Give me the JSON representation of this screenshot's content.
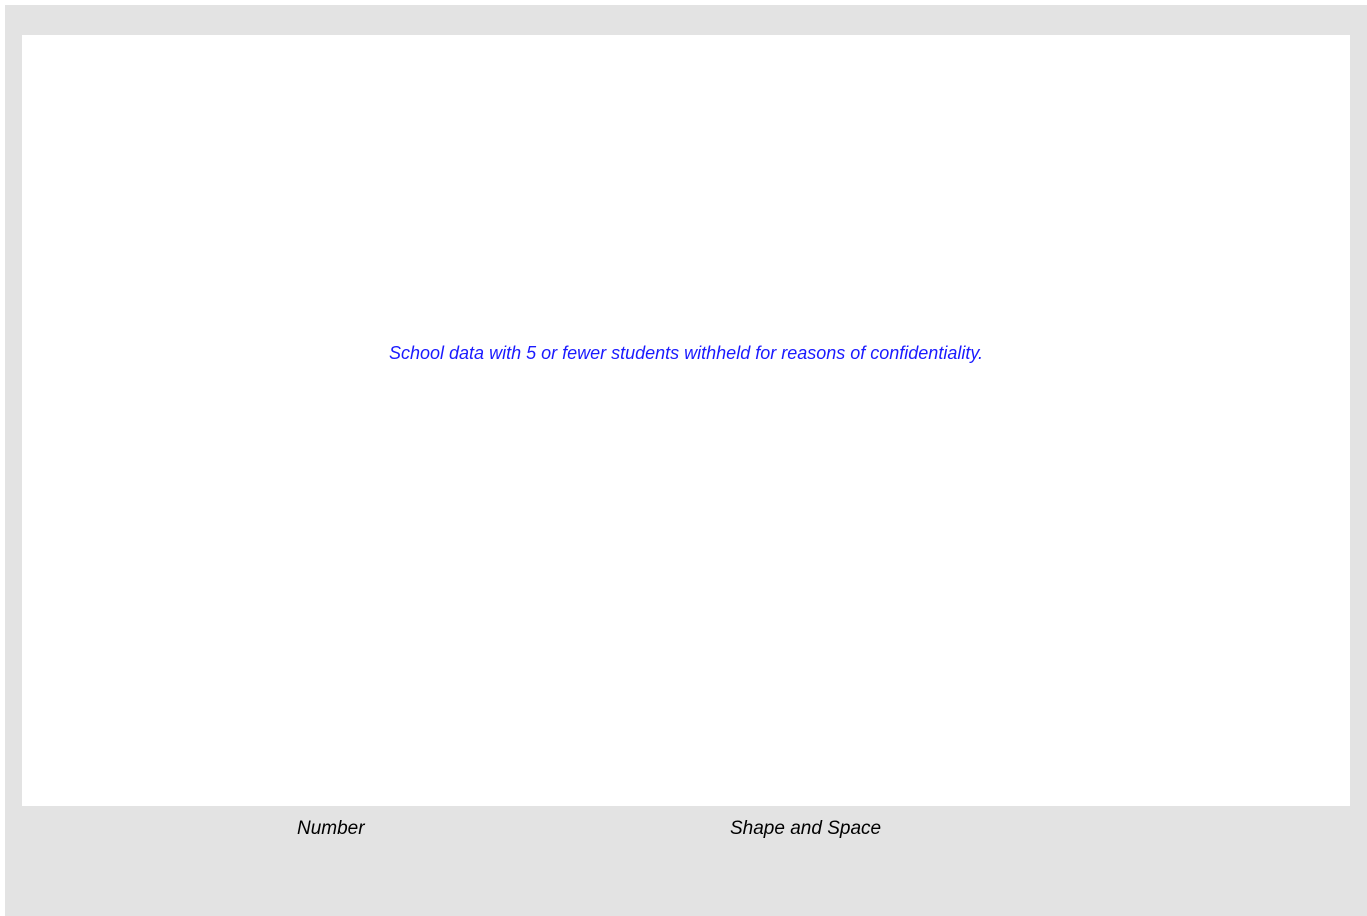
{
  "chart_data": {
    "type": "bar",
    "title": "",
    "xlabel": "",
    "ylabel": "",
    "categories": [
      "Number",
      "Shape and Space"
    ],
    "series": [],
    "annotation": "School data with 5 or fewer students withheld for reasons of confidentiality.",
    "grid": false,
    "legend": "none"
  },
  "colors": {
    "background": "#e3e3e3",
    "plot_background": "#ffffff",
    "notice_text": "#1a1aff"
  }
}
